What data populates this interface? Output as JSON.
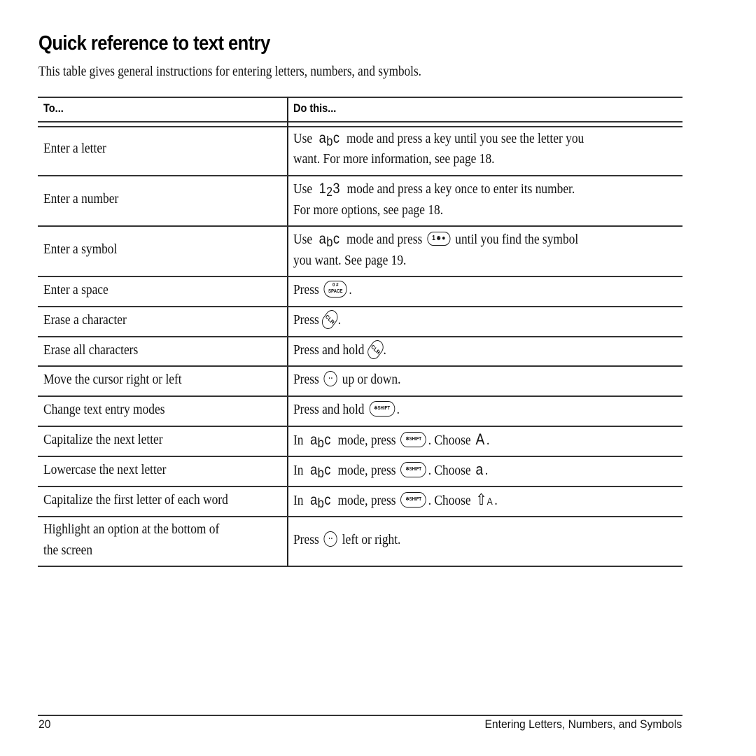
{
  "page": {
    "title": "Quick reference to text entry",
    "intro": "This table gives general instructions for entering letters, numbers, and symbols."
  },
  "table": {
    "headers": {
      "to": "To...",
      "do": "Do this..."
    },
    "rows": [
      {
        "to": "Enter a letter",
        "do_line1": [
          "Use",
          "abc",
          "mode and press a key until you see the letter you"
        ],
        "do_line2": "want. For more information, see page 18."
      },
      {
        "to": "Enter a number",
        "do_line1": [
          "Use",
          "123",
          "mode and press a key once to enter its number."
        ],
        "do_line2": "For more options, see page 18."
      },
      {
        "to": "Enter a symbol",
        "do_line1": [
          "Use",
          "abc",
          "mode and press",
          "symbol-key-icon",
          "until you find the symbol"
        ],
        "do_line2": "you want. See page 19."
      },
      {
        "to": "Enter a space",
        "do": [
          "Press",
          "space-key-icon",
          "."
        ]
      },
      {
        "to": "Erase a character",
        "do": [
          "Press",
          "clr-key-icon",
          "."
        ]
      },
      {
        "to": "Erase all characters",
        "do": [
          "Press and hold",
          "clr-key-icon",
          "."
        ]
      },
      {
        "to": "Move the cursor right or left",
        "do": [
          "Press",
          "navigation-key-icon",
          "up or down."
        ]
      },
      {
        "to": "Change text entry modes",
        "do": [
          "Press and hold",
          "shift-key-icon",
          "."
        ]
      },
      {
        "to": "Capitalize the next letter",
        "do": [
          "In",
          "abc",
          "mode, press",
          "shift-key-icon",
          ". Choose",
          "A",
          "."
        ]
      },
      {
        "to": "Lowercase the next letter",
        "do": [
          "In",
          "abc",
          "mode, press",
          "shift-key-icon",
          ". Choose",
          "a",
          "."
        ]
      },
      {
        "to": "Capitalize the first letter of each word",
        "do": [
          "In",
          "abc",
          "mode, press",
          "shift-key-icon",
          ". Choose",
          "word-caps-icon",
          "."
        ]
      },
      {
        "to_line1": "Highlight an option at the bottom of",
        "to_line2": "the screen",
        "do": [
          "Press",
          "navigation-key-icon",
          "left or right."
        ]
      }
    ]
  },
  "keys": {
    "symbol": "1☻●",
    "space_top": "0 #",
    "space_bottom": "SPACE",
    "clr": "CLR",
    "nav": "• •",
    "shift": "✻SHIFT",
    "mode_abc": {
      "a": "a",
      "b": "b",
      "c": "c"
    },
    "mode_123": {
      "one": "1",
      "two": "2",
      "three": "3"
    },
    "upper_a": "A",
    "lower_a": "a",
    "word_caps": "⇧"
  },
  "footer": {
    "page_number": "20",
    "section_title": "Entering Letters, Numbers, and Symbols"
  }
}
